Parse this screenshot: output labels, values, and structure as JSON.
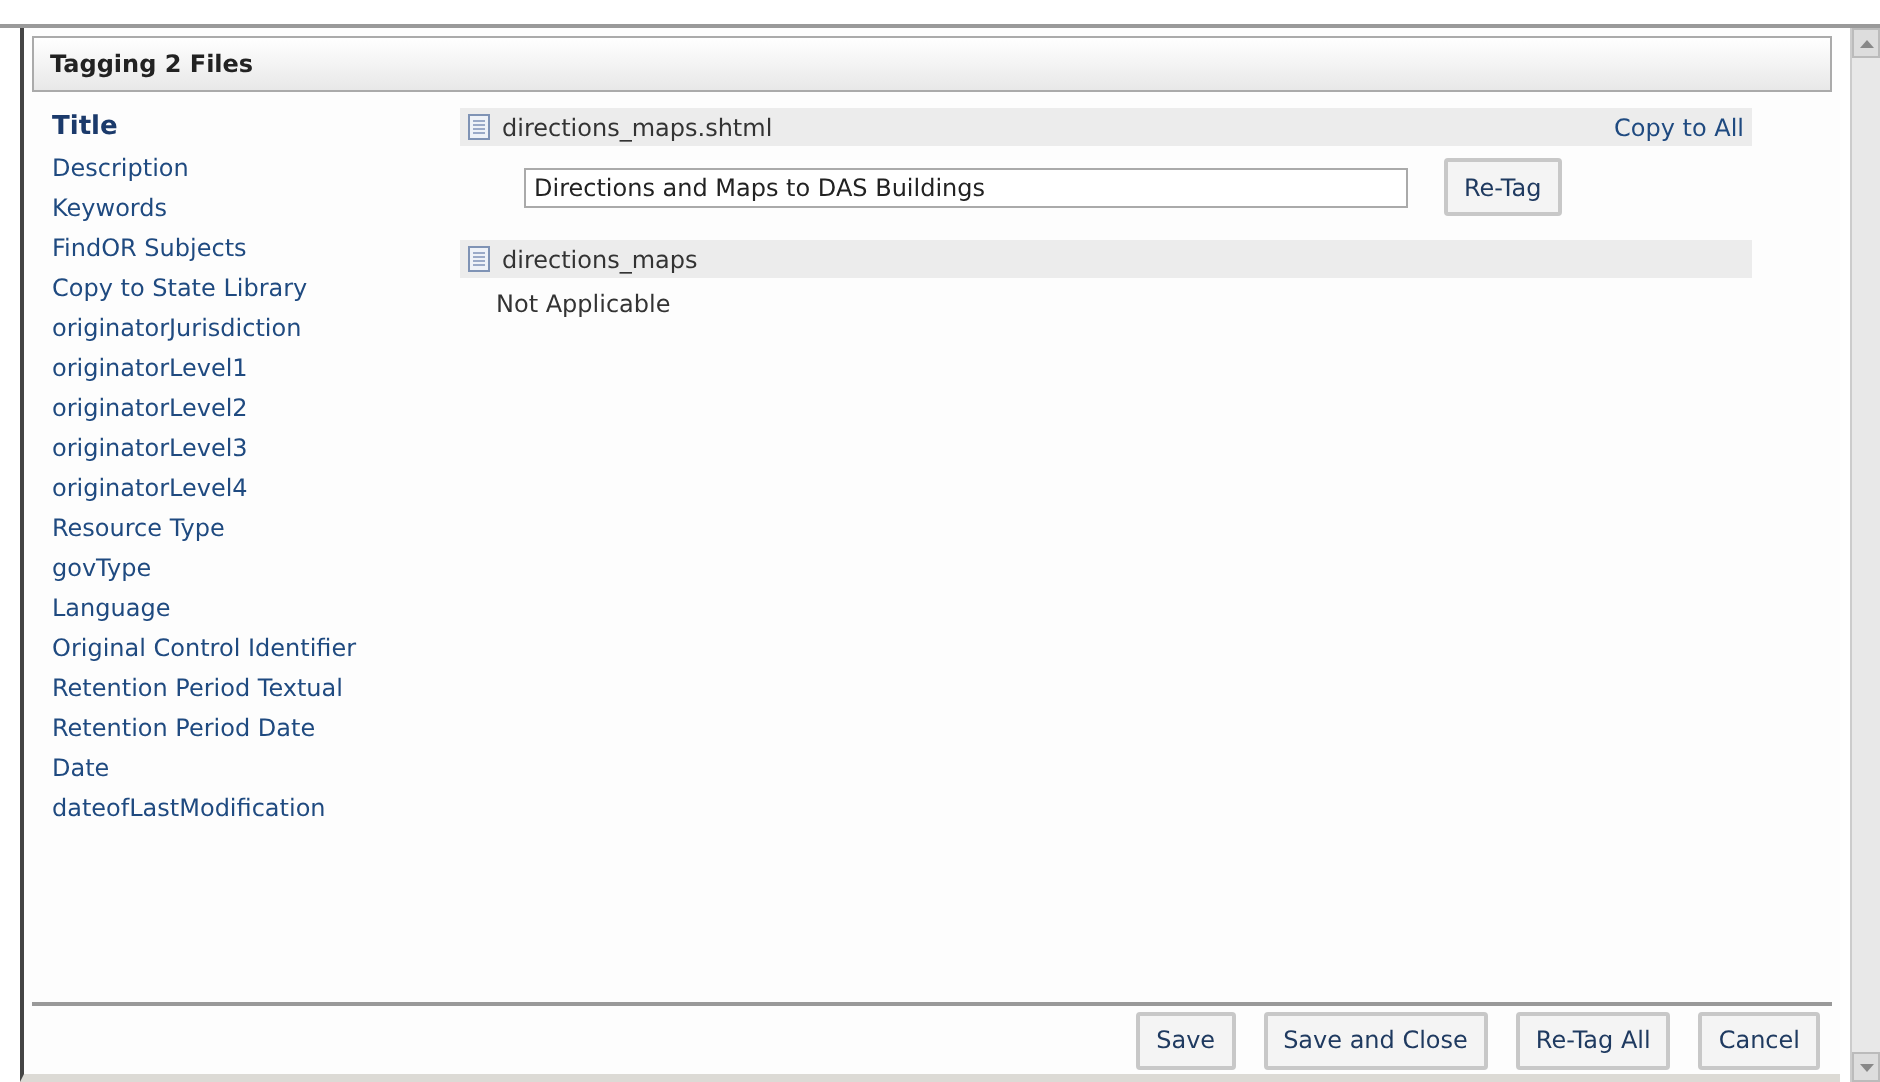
{
  "dialog": {
    "title": "Tagging 2 Files"
  },
  "fields": [
    {
      "label": "Title",
      "selected": true
    },
    {
      "label": "Description",
      "selected": false
    },
    {
      "label": "Keywords",
      "selected": false
    },
    {
      "label": "FindOR Subjects",
      "selected": false
    },
    {
      "label": "Copy to State Library",
      "selected": false
    },
    {
      "label": "originatorJurisdiction",
      "selected": false
    },
    {
      "label": "originatorLevel1",
      "selected": false
    },
    {
      "label": "originatorLevel2",
      "selected": false
    },
    {
      "label": "originatorLevel3",
      "selected": false
    },
    {
      "label": "originatorLevel4",
      "selected": false
    },
    {
      "label": "Resource Type",
      "selected": false
    },
    {
      "label": "govType",
      "selected": false
    },
    {
      "label": "Language",
      "selected": false
    },
    {
      "label": "Original Control Identifier",
      "selected": false
    },
    {
      "label": "Retention Period Textual",
      "selected": false
    },
    {
      "label": "Retention Period Date",
      "selected": false
    },
    {
      "label": "Date",
      "selected": false
    },
    {
      "label": "dateofLastModification",
      "selected": false
    }
  ],
  "files": [
    {
      "name": "directions_maps.shtml",
      "link": "Copy to All",
      "kind": "input",
      "value": "Directions and Maps to DAS Buildings",
      "button": "Re-Tag"
    },
    {
      "name": "directions_maps",
      "kind": "text",
      "text": "Not Applicable"
    }
  ],
  "buttons": [
    "Save",
    "Save and Close",
    "Re-Tag All",
    "Cancel"
  ]
}
